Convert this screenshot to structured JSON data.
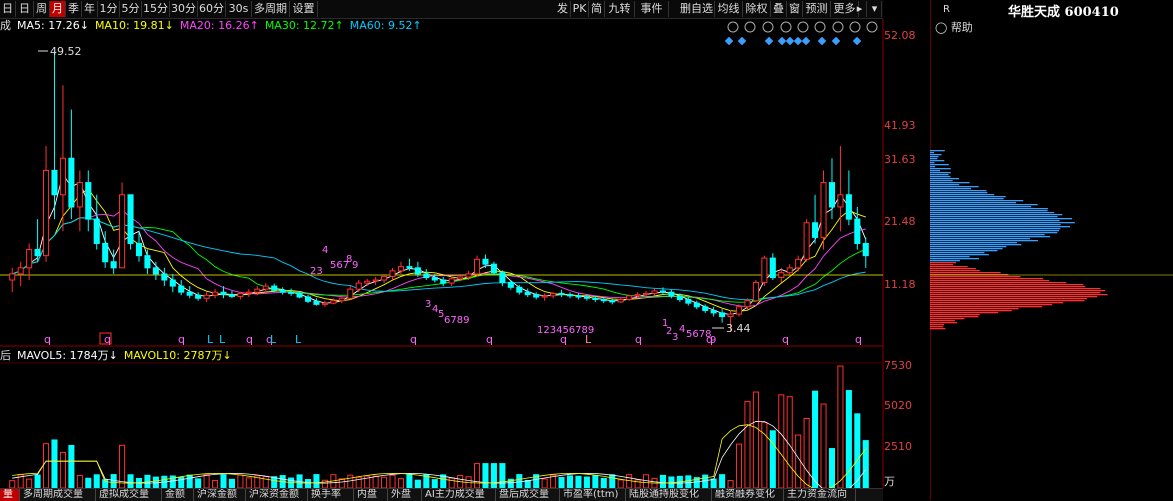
{
  "toolbar": {
    "left_items": [
      "日",
      "日",
      "周",
      "月",
      "季",
      "年",
      "1分",
      "5分",
      "15分",
      "30分",
      "60分",
      "30s",
      "多周期",
      "设置"
    ],
    "active_index": 3,
    "right_items": [
      "发",
      "PK",
      "简",
      "九转",
      "事件",
      "删自选",
      "均线",
      "除权",
      "叠",
      "窗",
      "预测",
      "更多"
    ]
  },
  "ma_legend": {
    "prefix": "成",
    "items": [
      {
        "label": "MA5: 17.26↓",
        "color": "#ffffff"
      },
      {
        "label": "MA10: 19.81↓",
        "color": "#ffff00"
      },
      {
        "label": "MA20: 16.26↑",
        "color": "#ff44ff"
      },
      {
        "label": "MA30: 12.72↑",
        "color": "#00ff00"
      },
      {
        "label": "MA60: 9.52↑",
        "color": "#00ccff"
      }
    ]
  },
  "vol_legend": {
    "prefix": "后",
    "items": [
      {
        "label": "MAVOL5: 1784万↓",
        "color": "#ffffff"
      },
      {
        "label": "MAVOL10: 2787万↓",
        "color": "#ffff00"
      }
    ]
  },
  "price_axis": [
    "52.08",
    "41.93",
    "31.63",
    "21.48",
    "11.18"
  ],
  "vol_axis": [
    "7530",
    "5020",
    "2510",
    "万"
  ],
  "annotations": {
    "high": "49.52",
    "low": "3.44",
    "q_marks": [
      "q",
      "q",
      "q",
      "q",
      "q",
      "q",
      "q",
      "q",
      "q",
      "q",
      "q",
      "q"
    ],
    "l_marks": [
      "L",
      "L",
      "L",
      "L",
      "L"
    ]
  },
  "right_panel": {
    "letter": "R",
    "title": "华胜天成 600410",
    "help": "帮助"
  },
  "bottom_tabs": [
    "量",
    "多周期成交量",
    "虚拟成交量",
    "金额",
    "沪深金额",
    "沪深资金额",
    "换手率",
    "内盘",
    "外盘",
    "AI主力成交量",
    "盘后成交量",
    "市盈率(ttm)",
    "陆股通持股变化",
    "融资融券变化",
    "主力资金流向"
  ],
  "chart_data": {
    "type": "candlestick",
    "period": "月",
    "price_ticks": [
      52.08,
      41.93,
      31.63,
      21.48,
      11.18
    ],
    "volume_ticks": [
      7530,
      5020,
      2510
    ],
    "max_price": 49.52,
    "min_price": 3.44,
    "last_price_line": 12.5,
    "moving_averages": {
      "MA5": 17.26,
      "MA10": 19.81,
      "MA20": 16.26,
      "MA30": 12.72,
      "MA60": 9.52
    },
    "volume_moving_averages": {
      "MAVOL5": 1784,
      "MAVOL10": 2787
    }
  }
}
